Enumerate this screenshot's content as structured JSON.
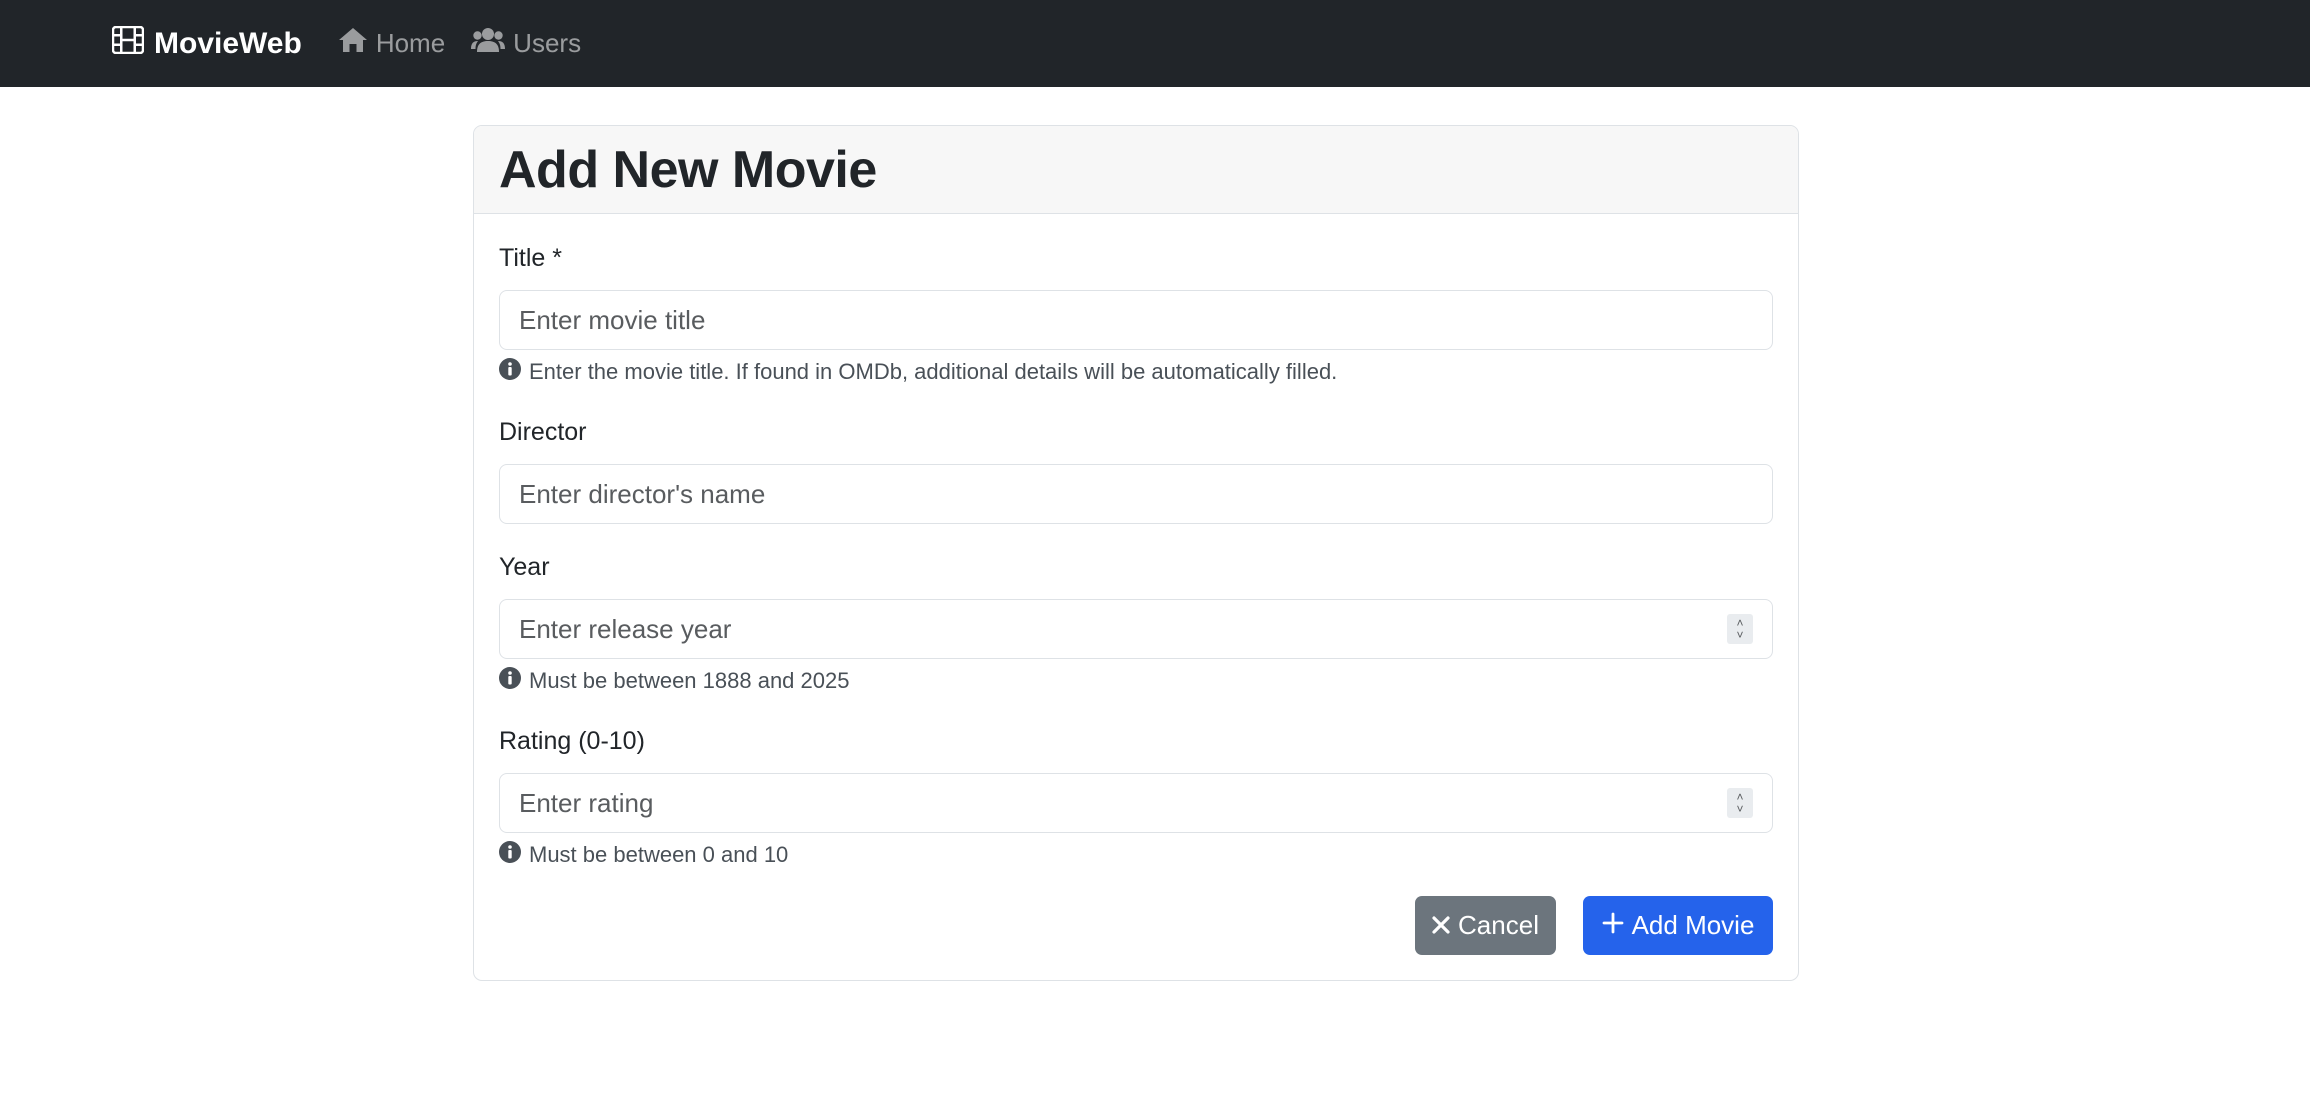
{
  "navbar": {
    "brand": "MovieWeb",
    "brand_icon": "film-icon",
    "links": [
      {
        "label": "Home",
        "icon": "home-icon"
      },
      {
        "label": "Users",
        "icon": "users-icon"
      }
    ]
  },
  "card": {
    "title": "Add New Movie"
  },
  "form": {
    "title": {
      "label": "Title *",
      "placeholder": "Enter movie title",
      "help": "Enter the movie title. If found in OMDb, additional details will be automatically filled."
    },
    "director": {
      "label": "Director",
      "placeholder": "Enter director's name"
    },
    "year": {
      "label": "Year",
      "placeholder": "Enter release year",
      "help": "Must be between 1888 and 2025"
    },
    "rating": {
      "label": "Rating (0-10)",
      "placeholder": "Enter rating",
      "help": "Must be between 0 and 10"
    }
  },
  "buttons": {
    "cancel": "Cancel",
    "add": "Add Movie"
  },
  "colors": {
    "navbar_bg": "#212529",
    "primary": "#2563eb",
    "secondary": "#6c757d"
  }
}
